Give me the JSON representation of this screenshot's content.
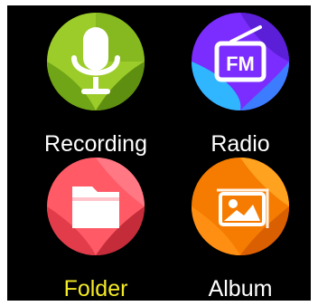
{
  "apps": [
    {
      "name": "recording",
      "label": "Recording",
      "icon": "microphone-icon",
      "colors": [
        "#9ccc2a",
        "#6fa516",
        "#4f7f0d"
      ],
      "selected": false
    },
    {
      "name": "radio",
      "label": "Radio",
      "icon": "fm-radio-icon",
      "colors": [
        "#2fb6ff",
        "#7b2cff",
        "#5a1fd6"
      ],
      "selected": false
    },
    {
      "name": "folder",
      "label": "Folder",
      "icon": "folder-icon",
      "colors": [
        "#ff5a66",
        "#e23c4a",
        "#b72634"
      ],
      "selected": true
    },
    {
      "name": "album",
      "label": "Album",
      "icon": "image-gallery-icon",
      "colors": [
        "#ffa21f",
        "#f57c00",
        "#d95f00"
      ],
      "selected": false
    }
  ],
  "selected_label_color": "#f3ea26",
  "background_color": "#000000"
}
